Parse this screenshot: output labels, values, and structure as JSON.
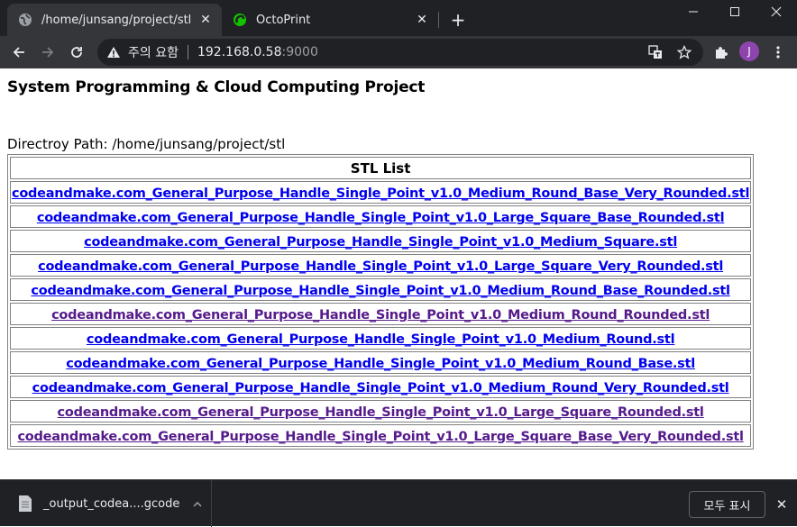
{
  "browser": {
    "tabs": [
      {
        "title": "/home/junsang/project/stl",
        "active": true
      },
      {
        "title": "OctoPrint",
        "active": false
      }
    ],
    "new_tab_symbol": "+",
    "window_controls": {
      "minimize": "—",
      "maximize": "☐",
      "close": "✕"
    },
    "omnibox": {
      "security_text": "주의 요함",
      "host": "192.168.0.58",
      "port": ":9000"
    },
    "profile_initial": "J",
    "icons": {
      "back": "arrow-left-icon",
      "forward": "arrow-right-icon",
      "reload": "reload-icon",
      "warning": "warning-triangle-icon",
      "translate": "translate-icon",
      "bookmark": "star-icon",
      "extensions": "puzzle-icon",
      "menu": "kebab-menu-icon"
    },
    "colors": {
      "tabbar": "#202124",
      "toolbar": "#35363a",
      "profile": "#8e44ad",
      "octoprint": "#13c100"
    }
  },
  "page": {
    "title": "System Programming & Cloud Computing Project",
    "directory_label": "Directroy Path:",
    "directory_path": "/home/junsang/project/stl",
    "table_header": "STL List",
    "files": [
      {
        "name": "codeandmake.com_General_Purpose_Handle_Single_Point_v1.0_Medium_Round_Base_Very_Rounded.stl",
        "visited": false
      },
      {
        "name": "codeandmake.com_General_Purpose_Handle_Single_Point_v1.0_Large_Square_Base_Rounded.stl",
        "visited": false
      },
      {
        "name": "codeandmake.com_General_Purpose_Handle_Single_Point_v1.0_Medium_Square.stl",
        "visited": false
      },
      {
        "name": "codeandmake.com_General_Purpose_Handle_Single_Point_v1.0_Large_Square_Very_Rounded.stl",
        "visited": false
      },
      {
        "name": "codeandmake.com_General_Purpose_Handle_Single_Point_v1.0_Medium_Round_Base_Rounded.stl",
        "visited": false
      },
      {
        "name": "codeandmake.com_General_Purpose_Handle_Single_Point_v1.0_Medium_Round_Rounded.stl",
        "visited": true
      },
      {
        "name": "codeandmake.com_General_Purpose_Handle_Single_Point_v1.0_Medium_Round.stl",
        "visited": false
      },
      {
        "name": "codeandmake.com_General_Purpose_Handle_Single_Point_v1.0_Medium_Round_Base.stl",
        "visited": false
      },
      {
        "name": "codeandmake.com_General_Purpose_Handle_Single_Point_v1.0_Medium_Round_Very_Rounded.stl",
        "visited": false
      },
      {
        "name": "codeandmake.com_General_Purpose_Handle_Single_Point_v1.0_Large_Square_Rounded.stl",
        "visited": true
      },
      {
        "name": "codeandmake.com_General_Purpose_Handle_Single_Point_v1.0_Large_Square_Base_Very_Rounded.stl",
        "visited": true
      }
    ],
    "link_colors": {
      "unvisited": "#0000ee",
      "visited": "#551a8b"
    }
  },
  "downloads": {
    "item_name": "_output_codea....gcode",
    "show_all_label": "모두 표시",
    "close_symbol": "✕"
  }
}
